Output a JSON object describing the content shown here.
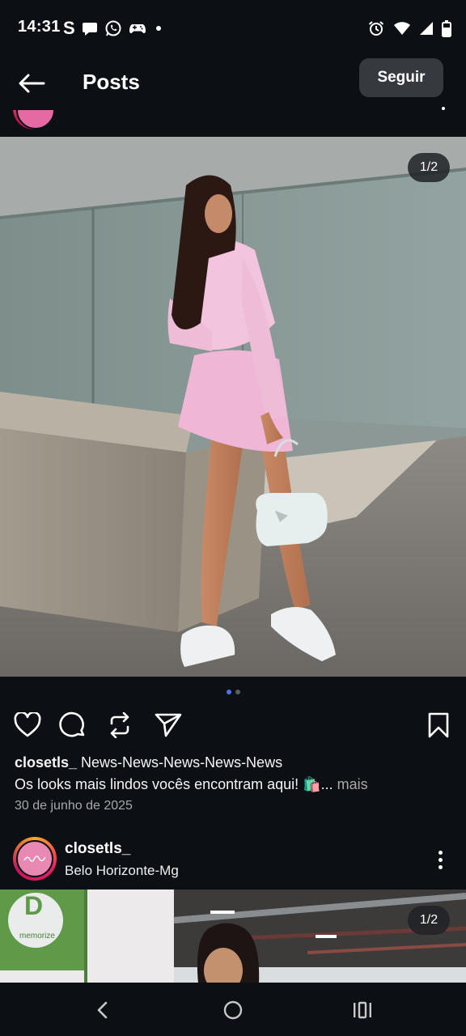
{
  "status_bar": {
    "time": "14:31",
    "left_icons": [
      "s-icon",
      "chat-bubble-icon",
      "whatsapp-icon",
      "game-controller-icon",
      "dot-icon"
    ],
    "right_icons": [
      "alarm-icon",
      "wifi-icon",
      "signal-icon",
      "battery-icon"
    ]
  },
  "header": {
    "title": "Posts",
    "follow_label": "Seguir"
  },
  "post": {
    "image_counter": "1/2",
    "carousel_total": 2,
    "carousel_active": 1,
    "caption_username": "closetls_",
    "caption_text": " News-News-News-News-News\nOs looks mais lindos vocês encontram aqui! 🛍️...",
    "caption_more": " mais",
    "date": "30 de junho de 2025"
  },
  "next_post": {
    "username": "closetls_",
    "location": "Belo Horizonte-Mg",
    "image_counter": "1/2",
    "sign_letter": "D",
    "sign_text": "memorize"
  },
  "colors": {
    "background": "#0c1014",
    "follow_button": "#363a3f",
    "carousel_active_dot": "#4a73f2",
    "muted_text": "#a8a8a8"
  }
}
